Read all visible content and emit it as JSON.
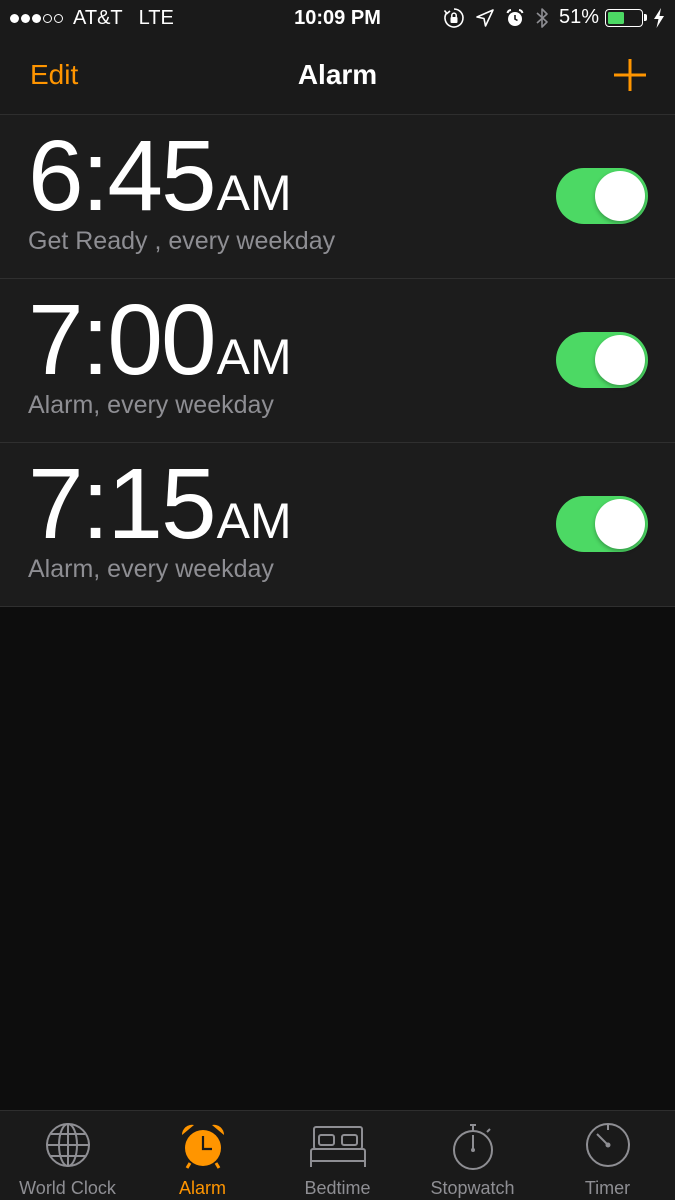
{
  "status_bar": {
    "signal": {
      "filled": 3,
      "total": 5
    },
    "carrier": "AT&T",
    "network": "LTE",
    "time": "10:09 PM",
    "icons": [
      "orientation-lock-icon",
      "location-icon",
      "alarm-icon",
      "bluetooth-icon"
    ],
    "battery_percent_label": "51%",
    "battery_level": 0.51,
    "charging_icon": "charging-bolt-icon"
  },
  "nav": {
    "edit_label": "Edit",
    "title": "Alarm",
    "add_icon": "plus-icon"
  },
  "alarms": [
    {
      "time": "6:45",
      "ampm": "AM",
      "label": "Get Ready , every weekday",
      "enabled": true
    },
    {
      "time": "7:00",
      "ampm": "AM",
      "label": "Alarm, every weekday",
      "enabled": true
    },
    {
      "time": "7:15",
      "ampm": "AM",
      "label": "Alarm, every weekday",
      "enabled": true
    }
  ],
  "tabs": [
    {
      "label": "World Clock",
      "icon": "globe-icon",
      "active": false
    },
    {
      "label": "Alarm",
      "icon": "alarm-clock-icon",
      "active": true
    },
    {
      "label": "Bedtime",
      "icon": "bed-icon",
      "active": false
    },
    {
      "label": "Stopwatch",
      "icon": "stopwatch-icon",
      "active": false
    },
    {
      "label": "Timer",
      "icon": "timer-icon",
      "active": false
    }
  ],
  "colors": {
    "accent": "#ff9500",
    "toggle_on": "#4cd964",
    "background": "#0d0d0d",
    "row_background": "#1c1c1c",
    "secondary_text": "#8e8e93"
  }
}
